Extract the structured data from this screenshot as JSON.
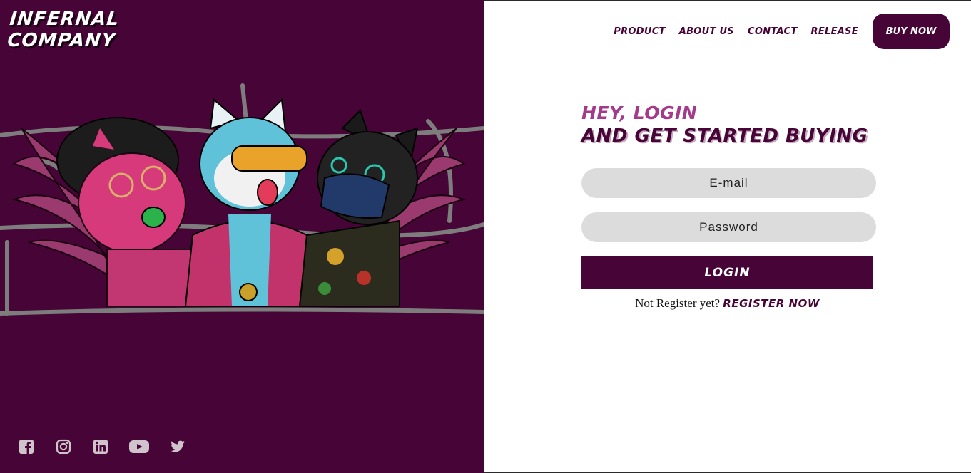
{
  "brand": {
    "line1": "INFERNAL",
    "line2": "COMPANY"
  },
  "nav": {
    "items": [
      {
        "label": "PRODUCT"
      },
      {
        "label": "ABOUT US"
      },
      {
        "label": "CONTACT"
      },
      {
        "label": "RELEASE"
      }
    ],
    "buy_label": "BUY NOW"
  },
  "login": {
    "heading_1": "HEY, LOGIN",
    "heading_2": "AND GET STARTED BUYING",
    "email_placeholder": "E-mail",
    "password_placeholder": "Password",
    "submit_label": "LOGIN",
    "register_prompt": "Not Register yet?",
    "register_link": "REGISTER NOW"
  },
  "socials": [
    "facebook-icon",
    "instagram-icon",
    "linkedin-icon",
    "youtube-icon",
    "twitter-icon"
  ],
  "colors": {
    "brand": "#470436",
    "accent": "#a33a8a",
    "field": "#dcdcdc"
  }
}
